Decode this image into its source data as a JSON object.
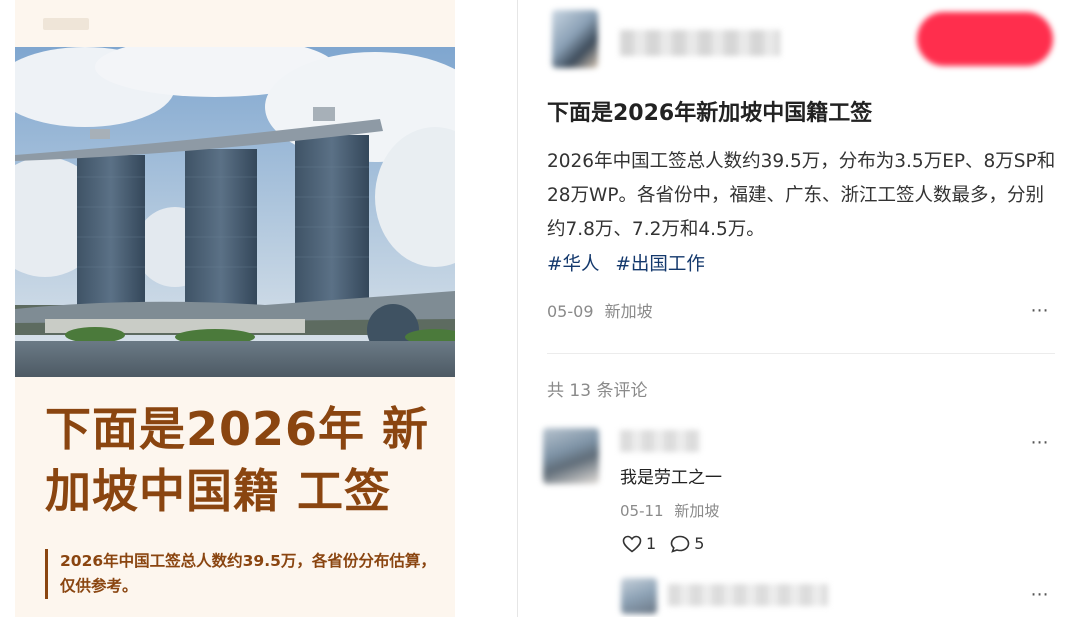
{
  "poster": {
    "title_line1": "下面是2026年 新",
    "title_line2": "加坡中国籍 工签",
    "subtitle": "2026年中国工签总人数约39.5万，各省份分布估算，仅供参考。"
  },
  "post": {
    "title": "下面是2026年新加坡中国籍工签",
    "body": "2026年中国工签总人数约39.5万，分布为3.5万EP、8万SP和28万WP。各省份中，福建、广东、浙江工签人数最多，分别约7.8万、7.2万和4.5万。",
    "hashtags": [
      "#华人",
      "#出国工作"
    ],
    "date": "05-09",
    "location": "新加坡"
  },
  "comments_header": "共 13 条评论",
  "comments": [
    {
      "text": "我是劳工之一",
      "date": "05-11",
      "location": "新加坡",
      "likes": "1",
      "replies": "5"
    }
  ],
  "icons": {
    "more": "more-dots-icon",
    "like": "heart-icon",
    "reply": "comment-bubble-icon"
  },
  "colors": {
    "accent": "#ff2e4d",
    "hashtag": "#13386c",
    "poster_brown": "#8a4510"
  }
}
